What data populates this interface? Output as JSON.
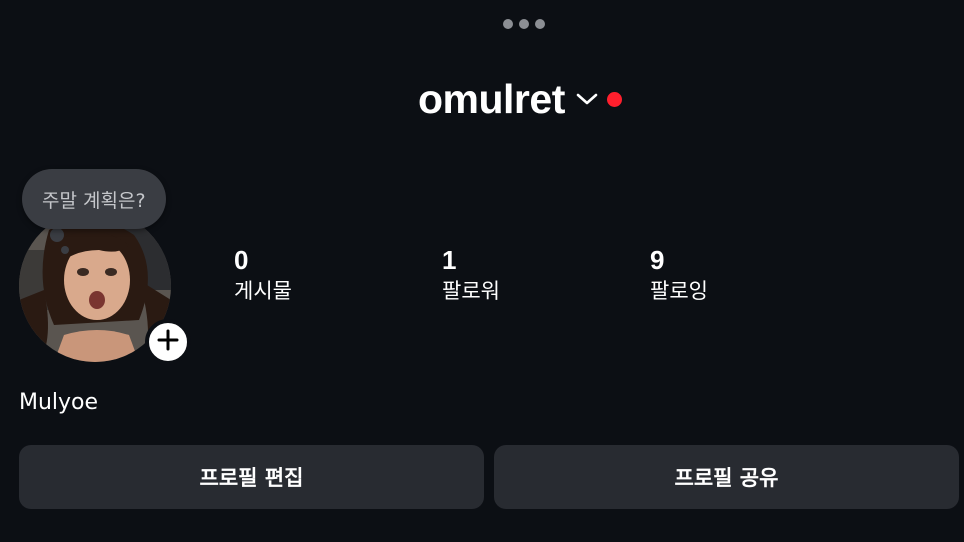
{
  "header": {
    "username": "omulret",
    "accent_dot_color": "#ff1f2d"
  },
  "top_bar": {
    "more_icon": "more-horizontal-icon"
  },
  "note": {
    "text": "주말 계획은?"
  },
  "avatar": {
    "add_icon": "plus-icon"
  },
  "stats": [
    {
      "value": "0",
      "label": "게시물"
    },
    {
      "value": "1",
      "label": "팔로워"
    },
    {
      "value": "9",
      "label": "팔로잉"
    }
  ],
  "profile": {
    "display_name": "Mulyoe"
  },
  "actions": {
    "edit_label": "프로필 편집",
    "share_label": "프로필 공유"
  }
}
